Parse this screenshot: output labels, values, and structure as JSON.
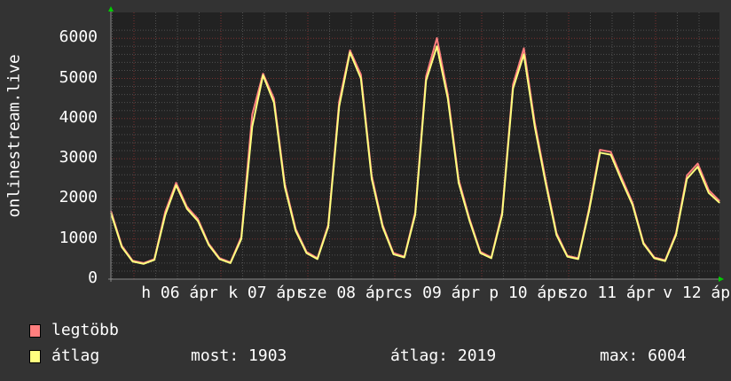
{
  "chart_data": {
    "type": "line",
    "ylabel": "onlinestream.live",
    "ylim": [
      0,
      6300
    ],
    "yticks": [
      "0",
      "1000",
      "2000",
      "3000",
      "4000",
      "5000",
      "6000"
    ],
    "xticks": [
      "h 06 ápr",
      "k 07 ápr",
      "sze 08 ápr",
      "cs 09 ápr",
      "p 10 ápr",
      "szo 11 ápr",
      "v 12 ápr"
    ],
    "grid": true,
    "x": [
      "04-05 18:00",
      "04-05 21:00",
      "04-06 00:00",
      "04-06 03:00",
      "04-06 06:00",
      "04-06 09:00",
      "04-06 12:00",
      "04-06 15:00",
      "04-06 18:00",
      "04-06 21:00",
      "04-07 00:00",
      "04-07 03:00",
      "04-07 06:00",
      "04-07 09:00",
      "04-07 12:00",
      "04-07 15:00",
      "04-07 18:00",
      "04-07 21:00",
      "04-08 00:00",
      "04-08 03:00",
      "04-08 06:00",
      "04-08 09:00",
      "04-08 12:00",
      "04-08 15:00",
      "04-08 18:00",
      "04-08 21:00",
      "04-09 00:00",
      "04-09 03:00",
      "04-09 06:00",
      "04-09 09:00",
      "04-09 12:00",
      "04-09 15:00",
      "04-09 18:00",
      "04-09 21:00",
      "04-10 00:00",
      "04-10 03:00",
      "04-10 06:00",
      "04-10 09:00",
      "04-10 12:00",
      "04-10 15:00",
      "04-10 18:00",
      "04-10 21:00",
      "04-11 00:00",
      "04-11 03:00",
      "04-11 06:00",
      "04-11 09:00",
      "04-11 12:00",
      "04-11 15:00",
      "04-11 18:00",
      "04-11 21:00",
      "04-12 00:00",
      "04-12 03:00",
      "04-12 06:00",
      "04-12 09:00",
      "04-12 12:00",
      "04-12 15:00",
      "04-12 18:00"
    ],
    "series": [
      {
        "name": "legtöbb",
        "color": "#ff7f7f",
        "values": [
          1700,
          830,
          460,
          400,
          500,
          1680,
          2400,
          1800,
          1500,
          880,
          520,
          420,
          1050,
          4100,
          5120,
          4500,
          2380,
          1250,
          680,
          520,
          1350,
          4420,
          5700,
          5100,
          2580,
          1350,
          650,
          560,
          1660,
          5050,
          6004,
          4600,
          2480,
          1500,
          680,
          540,
          1660,
          4850,
          5750,
          3900,
          2480,
          1150,
          580,
          520,
          1760,
          3220,
          3170,
          2520,
          1900,
          910,
          540,
          470,
          1140,
          2580,
          2880,
          2220,
          1950
        ]
      },
      {
        "name": "átlag",
        "color": "#ffff7f",
        "values": [
          1650,
          800,
          440,
          380,
          480,
          1600,
          2340,
          1750,
          1450,
          850,
          500,
          400,
          1000,
          3800,
          5080,
          4400,
          2300,
          1200,
          650,
          500,
          1300,
          4300,
          5650,
          5000,
          2500,
          1300,
          620,
          540,
          1600,
          4950,
          5800,
          4500,
          2400,
          1450,
          650,
          520,
          1600,
          4750,
          5600,
          3800,
          2400,
          1100,
          560,
          500,
          1700,
          3150,
          3100,
          2450,
          1850,
          880,
          520,
          450,
          1100,
          2500,
          2800,
          2150,
          1903
        ]
      }
    ],
    "legend": {
      "items": [
        "legtöbb",
        "átlag"
      ],
      "stats": {
        "now_label": "most: 1903",
        "avg_label": "átlag: 2019",
        "max_label": "max: 6004"
      }
    }
  }
}
